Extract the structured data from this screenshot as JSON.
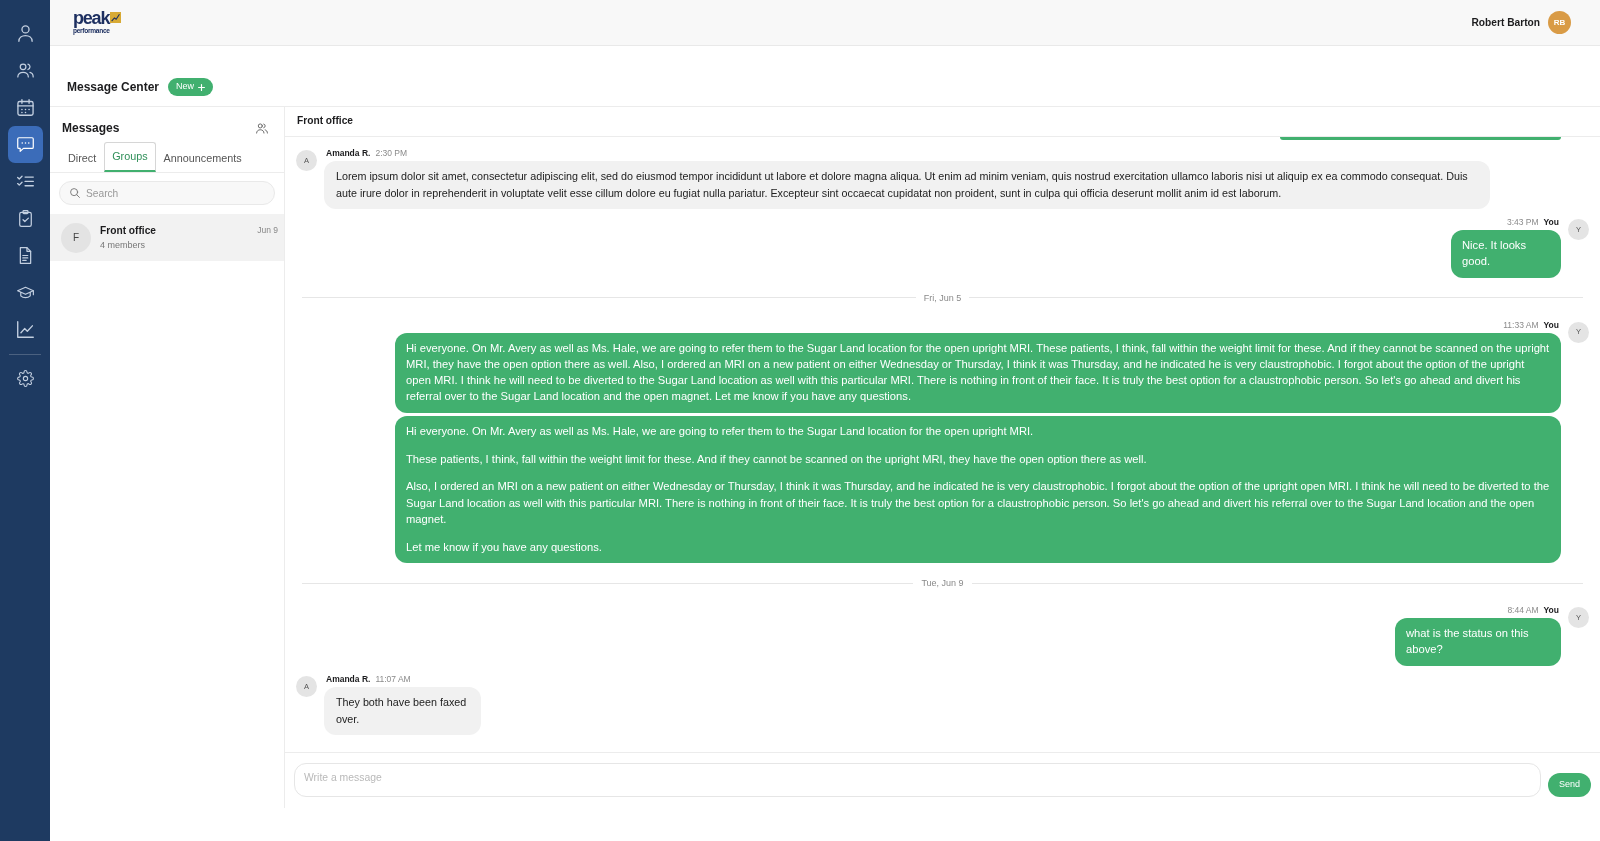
{
  "sidebar": {
    "items": [
      {
        "selected": false
      },
      {
        "selected": false
      },
      {
        "selected": false
      },
      {
        "selected": true
      },
      {
        "selected": false
      },
      {
        "selected": false
      },
      {
        "selected": false
      },
      {
        "selected": false
      },
      {
        "selected": false
      }
    ],
    "footer_items": [
      {
        "selected": false
      }
    ]
  },
  "header": {
    "logo": {
      "text": "peak",
      "subtext": "performance"
    },
    "user": {
      "name": "Robert Barton",
      "initials": "RB"
    }
  },
  "page": {
    "title": "Message Center",
    "new_button": "New"
  },
  "messages_panel": {
    "title": "Messages",
    "tabs": [
      {
        "label": "Direct",
        "selected": false
      },
      {
        "label": "Groups",
        "selected": true
      },
      {
        "label": "Announcements",
        "selected": false
      }
    ],
    "search": {
      "placeholder": "Search"
    },
    "conversations": [
      {
        "initial": "F",
        "name": "Front office",
        "subtitle": "4 members",
        "date": "Jun 9",
        "selected": true
      }
    ]
  },
  "chat": {
    "title": "Front office",
    "messages": [
      {
        "kind": "clipped",
        "outgoing": true
      },
      {
        "kind": "message",
        "outgoing": false,
        "initial": "A",
        "sender": "Amanda R.",
        "time": "2:30 PM",
        "paragraphs": [
          "Lorem ipsum dolor sit amet, consectetur adipiscing elit, sed do eiusmod tempor incididunt ut labore et dolore magna aliqua. Ut enim ad minim veniam, quis nostrud exercitation ullamco laboris nisi ut aliquip ex ea commodo consequat. Duis aute irure dolor in reprehenderit in voluptate velit esse cillum dolore eu fugiat nulla pariatur. Excepteur sint occaecat cupidatat non proident, sunt in culpa qui officia deserunt mollit anim id est laborum."
        ]
      },
      {
        "kind": "message",
        "outgoing": true,
        "initial": "Y",
        "sender": "You",
        "time": "3:43 PM",
        "paragraphs": [
          "Nice. It looks good."
        ]
      },
      {
        "kind": "date",
        "label": "Fri, Jun 5"
      },
      {
        "kind": "message",
        "outgoing": true,
        "initial": "Y",
        "sender": "You",
        "time": "11:33 AM",
        "paragraphs": [
          "Hi everyone. On Mr. Avery as well as Ms. Hale, we are going to refer them to the Sugar Land location for the open upright MRI. These patients, I think, fall within the weight limit for these. And if they cannot be scanned on the upright MRI, they have the open option there as well. Also, I ordered an MRI on a new patient on either Wednesday or Thursday, I think it was Thursday, and he indicated he is very claustrophobic. I forgot about the option of the upright open MRI. I think he will need to be diverted to the Sugar Land location as well with this particular MRI. There is nothing in front of their face. It is truly the best option for a claustrophobic person. So let's go ahead and divert his referral over to the Sugar Land location and the open magnet. Let me know if you have any questions."
        ]
      },
      {
        "kind": "message",
        "outgoing": true,
        "paragraphs": [
          "Hi everyone. On Mr. Avery as well as Ms. Hale, we are going to refer them to the Sugar Land location for the open upright MRI.",
          "These patients, I think, fall within the weight limit for these. And if they cannot be scanned on the upright MRI, they have the open option there as well.",
          "Also, I ordered an MRI on a new patient on either Wednesday or Thursday, I think it was Thursday, and he indicated he is very claustrophobic. I forgot about the option of the upright open MRI. I think he will need to be diverted to the Sugar Land location as well with this particular MRI. There is nothing in front of their face. It is truly the best option for a claustrophobic person. So let's go ahead and divert his referral over to the Sugar Land location and the open magnet.",
          "Let me know if you have any questions."
        ]
      },
      {
        "kind": "date",
        "label": "Tue, Jun 9"
      },
      {
        "kind": "message",
        "outgoing": true,
        "initial": "Y",
        "sender": "You",
        "time": "8:44 AM",
        "paragraphs": [
          "what is the status on this above?"
        ]
      },
      {
        "kind": "message",
        "outgoing": false,
        "initial": "A",
        "sender": "Amanda R.",
        "time": "11:07 AM",
        "paragraphs": [
          "They both have been faxed over."
        ]
      }
    ],
    "composer": {
      "placeholder": "Write a message",
      "send_label": "Send"
    }
  }
}
